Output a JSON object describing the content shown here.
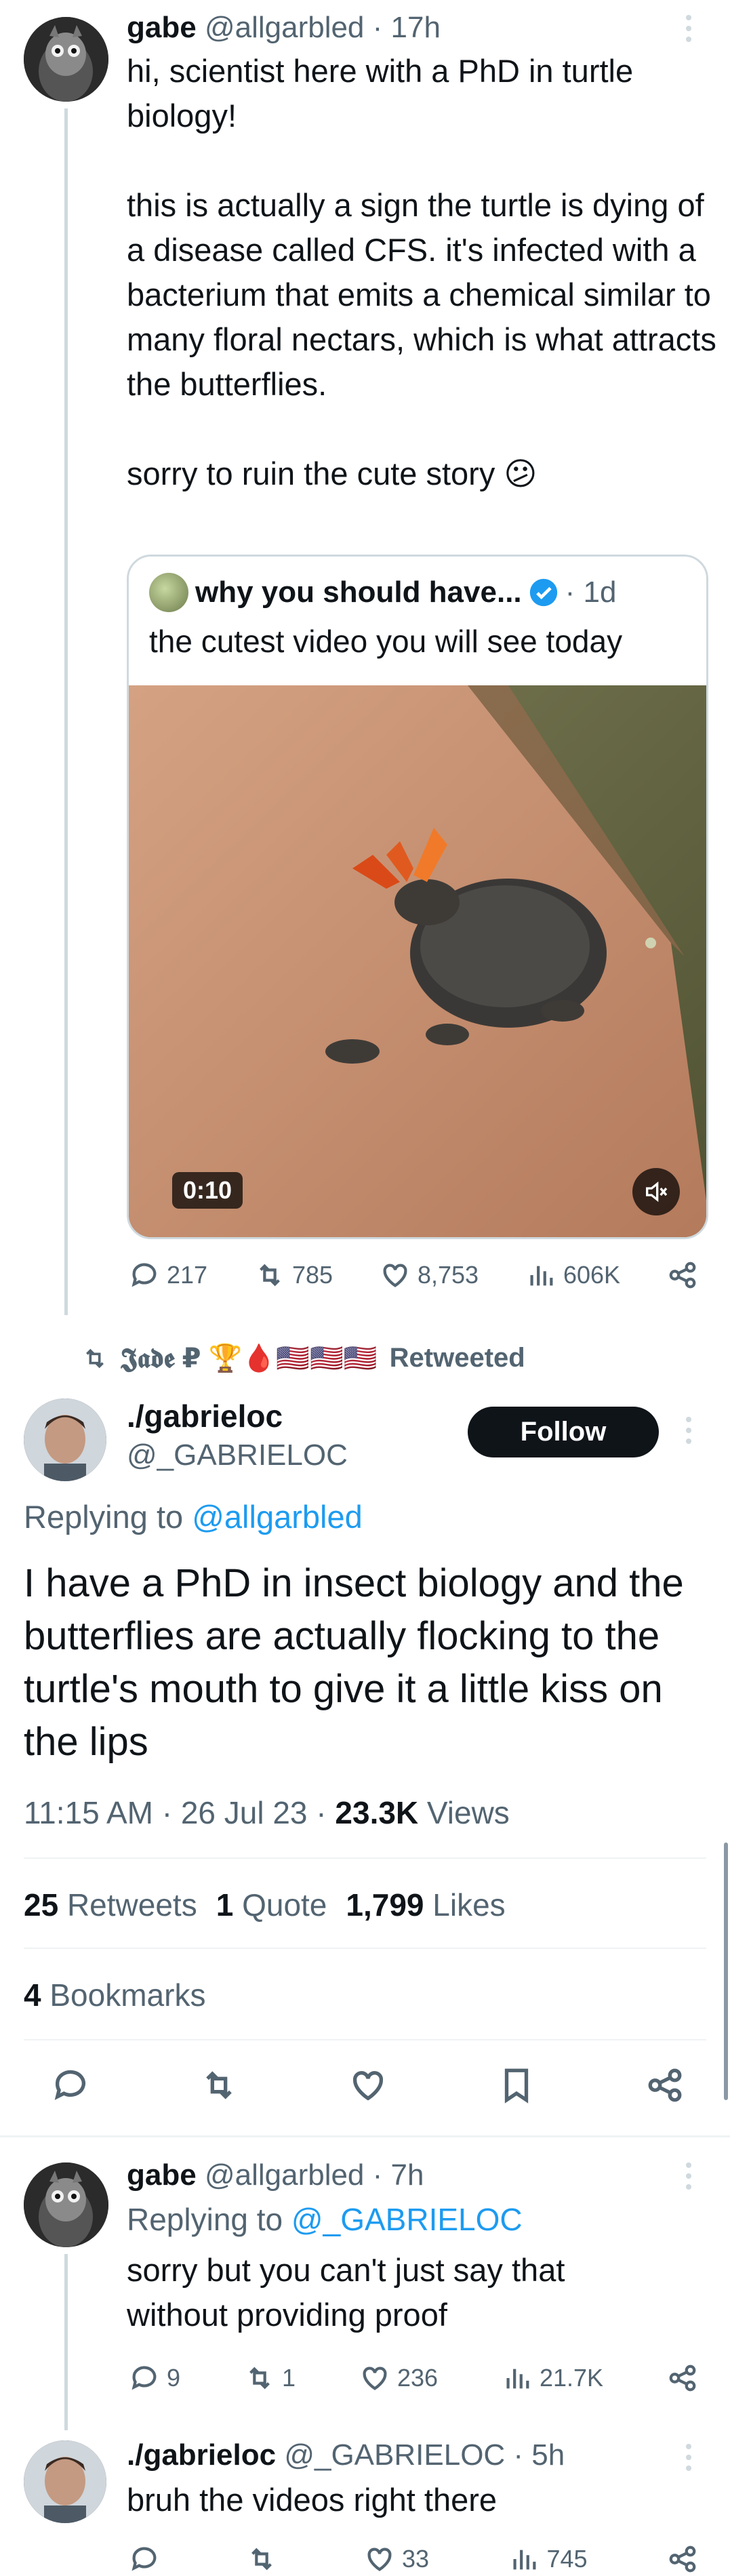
{
  "tweet1": {
    "display_name": "gabe",
    "handle_time": "@allgarbled · 17h",
    "text": "hi, scientist here with a PhD in turtle biology!\n\nthis is actually a sign the turtle is dying of a disease called CFS. it's infected with a bacterium that emits a chemical similar to many floral nectars, which is what attracts the butterflies.\n\nsorry to ruin the cute story 😕",
    "quote": {
      "name": "why you should have...",
      "time": "· 1d",
      "text": "the cutest video you will see today",
      "video_duration": "0:10"
    },
    "actions": {
      "replies": "217",
      "retweets": "785",
      "likes": "8,753",
      "views": "606K"
    }
  },
  "retweet_banner": {
    "retweeter": "𝕵𝖆𝖉𝖊 ₽ 🏆🩸🇺🇸🇺🇸🇺🇸",
    "suffix": "Retweeted"
  },
  "main_tweet": {
    "display_name": "./gabrieloc",
    "handle": "@_GABRIELOC",
    "follow_label": "Follow",
    "replying_prefix": "Replying to ",
    "replying_handle": "@allgarbled",
    "text": "I have a PhD in insect biology and the butterflies are actually flocking to the turtle's mouth to give it a little kiss on the lips",
    "timestamp": "11:15 AM · 26 Jul 23 · ",
    "views_count": "23.3K",
    "views_label": " Views",
    "retweets_count": "25",
    "retweets_label": " Retweets",
    "quotes_count": "1",
    "quotes_label": " Quote",
    "likes_count": "1,799",
    "likes_label": " Likes",
    "bookmarks_count": "4",
    "bookmarks_label": " Bookmarks"
  },
  "reply1": {
    "display_name": "gabe",
    "handle_time": "@allgarbled · 7h",
    "replying_prefix": "Replying to ",
    "replying_handle": "@_GABRIELOC",
    "text": "sorry but you can't just say that without providing proof",
    "actions": {
      "replies": "9",
      "retweets": "1",
      "likes": "236",
      "views": "21.7K"
    }
  },
  "reply2": {
    "display_name": "./gabrieloc",
    "handle_time": "@_GABRIELOC · 5h",
    "text": "bruh the videos right there",
    "actions": {
      "replies": "",
      "retweets": "",
      "likes": "33",
      "views": "745"
    }
  },
  "colors": {
    "accent": "#1d9bf0",
    "text": "#0f1419",
    "muted": "#536471",
    "border": "#cfd9de"
  }
}
